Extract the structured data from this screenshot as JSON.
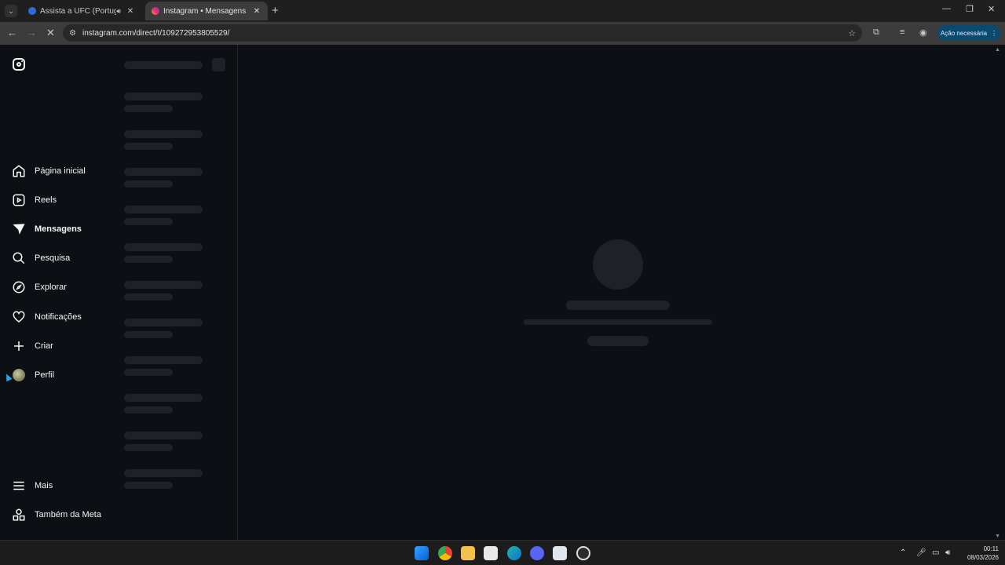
{
  "browser": {
    "tabs": [
      {
        "title": "Assista a UFC (Português) L",
        "active": false,
        "audio": true
      },
      {
        "title": "Instagram • Mensagens",
        "active": true,
        "audio": false
      }
    ],
    "url": "instagram.com/direct/t/109272953805529/",
    "action_label": "Ação necessária"
  },
  "sidebar": {
    "items": [
      {
        "label": "Página inicial",
        "icon": "home-icon"
      },
      {
        "label": "Reels",
        "icon": "reels-icon"
      },
      {
        "label": "Mensagens",
        "icon": "messages-icon",
        "active": true
      },
      {
        "label": "Pesquisa",
        "icon": "search-icon"
      },
      {
        "label": "Explorar",
        "icon": "explore-icon"
      },
      {
        "label": "Notificações",
        "icon": "heart-icon"
      },
      {
        "label": "Criar",
        "icon": "plus-icon"
      },
      {
        "label": "Perfil",
        "icon": "avatar"
      }
    ],
    "more_label": "Mais",
    "meta_label": "Também da Meta"
  },
  "taskbar": {
    "time": "00:11",
    "date": "08/03/2026"
  },
  "colors": {
    "page_bg": "#0c1014",
    "skeleton": "#1e2226",
    "tab_active": "#3c3c3c",
    "action_pill": "#0b4a6f"
  }
}
